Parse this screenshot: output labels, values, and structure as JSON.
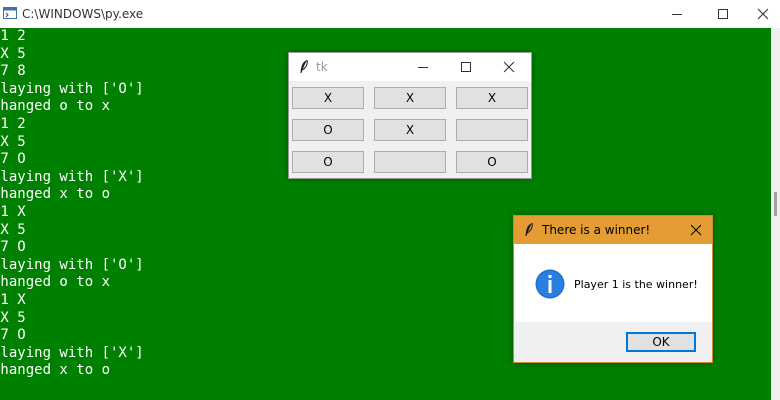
{
  "console": {
    "title": "C:\\WINDOWS\\py.exe",
    "lines": [
      " 1 2",
      " X 5",
      " 7 8",
      "Playing with ['O']",
      "changed o to x",
      " 1 2",
      " X 5",
      " 7 O",
      "Playing with ['X']",
      "changed x to o",
      " 1 X",
      " X 5",
      " 7 O",
      "Playing with ['O']",
      "changed o to x",
      " 1 X",
      " X 5",
      " 7 O",
      "Playing with ['X']",
      "changed x to o"
    ],
    "colors": {
      "background": "#008000",
      "text": "#ffffff"
    }
  },
  "tk": {
    "title": "tk",
    "board": [
      [
        "X",
        "X",
        "X"
      ],
      [
        "O",
        "X",
        ""
      ],
      [
        "O",
        "",
        "O"
      ]
    ]
  },
  "dialog": {
    "title": "There is a winner!",
    "message": "Player 1 is the winner!",
    "ok_label": "OK",
    "icon": "info-icon",
    "colors": {
      "titlebar": "#e49c34",
      "accent": "#0078d7"
    }
  }
}
